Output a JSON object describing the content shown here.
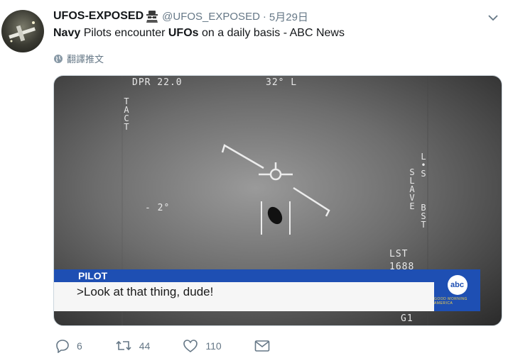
{
  "tweet": {
    "display_name": "UFOS-EXPOSED",
    "handle": "@UFOS_EXPOSED",
    "separator": "·",
    "date": "5月29日",
    "text_bold_1": "Navy",
    "text_1": " Pilots encounter ",
    "text_bold_2": "UFOs",
    "text_2": " on a daily basis - ABC News",
    "translate_label": "翻譯推文"
  },
  "video": {
    "hud_top_left": "DPR  22.0",
    "hud_top_center": "32° L",
    "hud_left_vertical": "TACT",
    "hud_right_vertical_1": "L•S",
    "hud_right_vertical_2": "SLAVE",
    "hud_right_vertical_3": "BST",
    "hud_angle": "- 2°",
    "hud_lst_label": "LST",
    "hud_lst_value": "1688",
    "hud_bottom_right": "G1",
    "lower_third_label": "PILOT",
    "lower_third_quote": ">Look at that thing, dude!",
    "network_logo": "abc",
    "network_sub": "GOOD MORNING AMERICA"
  },
  "actions": {
    "reply_count": "6",
    "retweet_count": "44",
    "like_count": "110"
  },
  "colors": {
    "muted": "#657786",
    "banner_blue": "#1e4fb3"
  },
  "icons": [
    "spy-icon",
    "chevron-down-icon",
    "globe-icon",
    "reply-icon",
    "retweet-icon",
    "like-icon",
    "message-icon"
  ]
}
